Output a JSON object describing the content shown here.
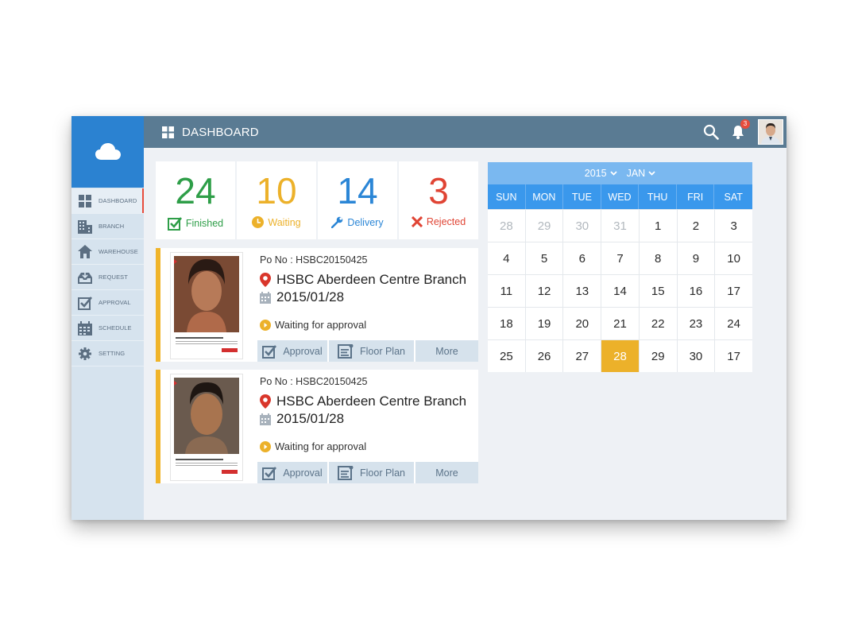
{
  "header": {
    "title": "DASHBOARD",
    "notification_count": "3"
  },
  "sidebar": {
    "items": [
      {
        "label": "DASHBOARD",
        "icon": "grid-icon",
        "active": true
      },
      {
        "label": "BRANCH",
        "icon": "building-icon"
      },
      {
        "label": "WAREHOUSE",
        "icon": "house-icon"
      },
      {
        "label": "REQUEST",
        "icon": "inbox-icon"
      },
      {
        "label": "APPROVAL",
        "icon": "checkbox-icon"
      },
      {
        "label": "SCHEDULE",
        "icon": "calendar-icon"
      },
      {
        "label": "SETTING",
        "icon": "gear-icon"
      }
    ]
  },
  "stats": [
    {
      "value": "24",
      "label": "Finished",
      "color": "#2e9e48"
    },
    {
      "value": "10",
      "label": "Waiting",
      "color": "#ecb12a"
    },
    {
      "value": "14",
      "label": "Delivery",
      "color": "#2b86d6"
    },
    {
      "value": "3",
      "label": "Rejected",
      "color": "#e04434"
    }
  ],
  "orders": [
    {
      "po": "Po No : HSBC20150425",
      "branch": "HSBC Aberdeen Centre Branch",
      "date": "2015/01/28",
      "status": "Waiting for approval",
      "actions": {
        "approval": "Approval",
        "floor_plan": "Floor Plan",
        "more": "More"
      }
    },
    {
      "po": "Po No : HSBC20150425",
      "branch": "HSBC Aberdeen Centre Branch",
      "date": "2015/01/28",
      "status": "Waiting for approval",
      "actions": {
        "approval": "Approval",
        "floor_plan": "Floor Plan",
        "more": "More"
      }
    }
  ],
  "calendar": {
    "year": "2015",
    "month": "JAN",
    "weekdays": [
      "SUN",
      "MON",
      "TUE",
      "WED",
      "THU",
      "FRI",
      "SAT"
    ],
    "weeks": [
      [
        "28",
        "29",
        "30",
        "31",
        "1",
        "2",
        "3"
      ],
      [
        "4",
        "5",
        "6",
        "7",
        "8",
        "9",
        "10"
      ],
      [
        "11",
        "12",
        "13",
        "14",
        "15",
        "16",
        "17"
      ],
      [
        "18",
        "19",
        "20",
        "21",
        "22",
        "23",
        "24"
      ],
      [
        "25",
        "26",
        "27",
        "28",
        "29",
        "30",
        "17"
      ]
    ],
    "muted": [
      [
        0,
        0
      ],
      [
        0,
        1
      ],
      [
        0,
        2
      ],
      [
        0,
        3
      ]
    ],
    "selected": [
      4,
      3
    ],
    "colors": {
      "header": "#7ab8f0",
      "weekdays": "#3a98ec",
      "selected": "#ecb12a"
    }
  }
}
